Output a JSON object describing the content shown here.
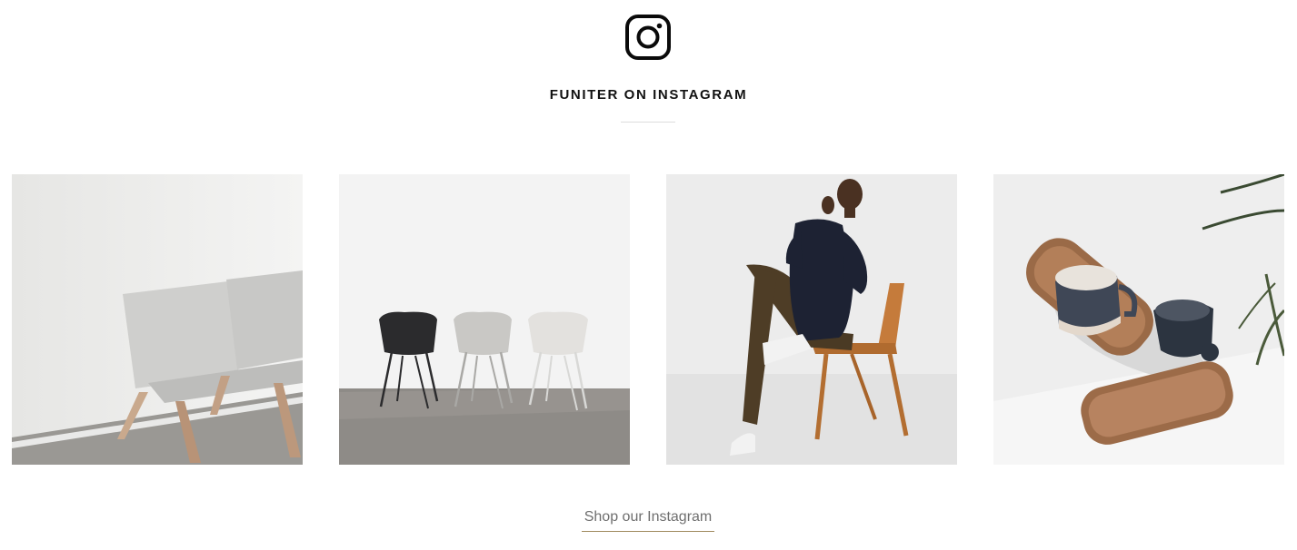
{
  "section": {
    "icon": "instagram-icon",
    "title": "FUNITER ON INSTAGRAM"
  },
  "gallery": {
    "items": [
      {
        "icon": "bench-photo"
      },
      {
        "icon": "chairs-photo"
      },
      {
        "icon": "man-on-chair-photo"
      },
      {
        "icon": "mugs-tray-photo"
      }
    ]
  },
  "footer": {
    "link_label": "Shop our Instagram"
  },
  "colors": {
    "title": "#111111",
    "link": "#6f6f6f",
    "link_underline": "#a08a5e"
  }
}
